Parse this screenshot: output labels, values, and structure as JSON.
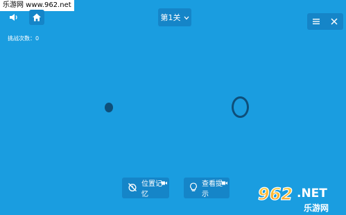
{
  "watermark": {
    "top_left_text": "乐游网 www.962.net",
    "logo_text": "962.NET",
    "logo_subtext": "乐游网"
  },
  "header": {
    "sound_icon": "speaker-icon",
    "home_icon": "home-icon",
    "level_label": "第1关",
    "level_dropdown_icon": "chevron-down-icon",
    "menu_icon": "menu-icon",
    "close_icon": "close-icon"
  },
  "status": {
    "challenge_count_label": "挑战次数：0"
  },
  "game": {
    "dot_color": "#0e4f7a",
    "ring_color": "#0e4f7a",
    "background_color": "#1a9de0"
  },
  "footer": {
    "memory_label": "位置记忆",
    "memory_icon": "clock-off-icon",
    "hint_label": "查看提示",
    "hint_icon": "lightbulb-icon",
    "video_badge_icon": "video-icon"
  }
}
